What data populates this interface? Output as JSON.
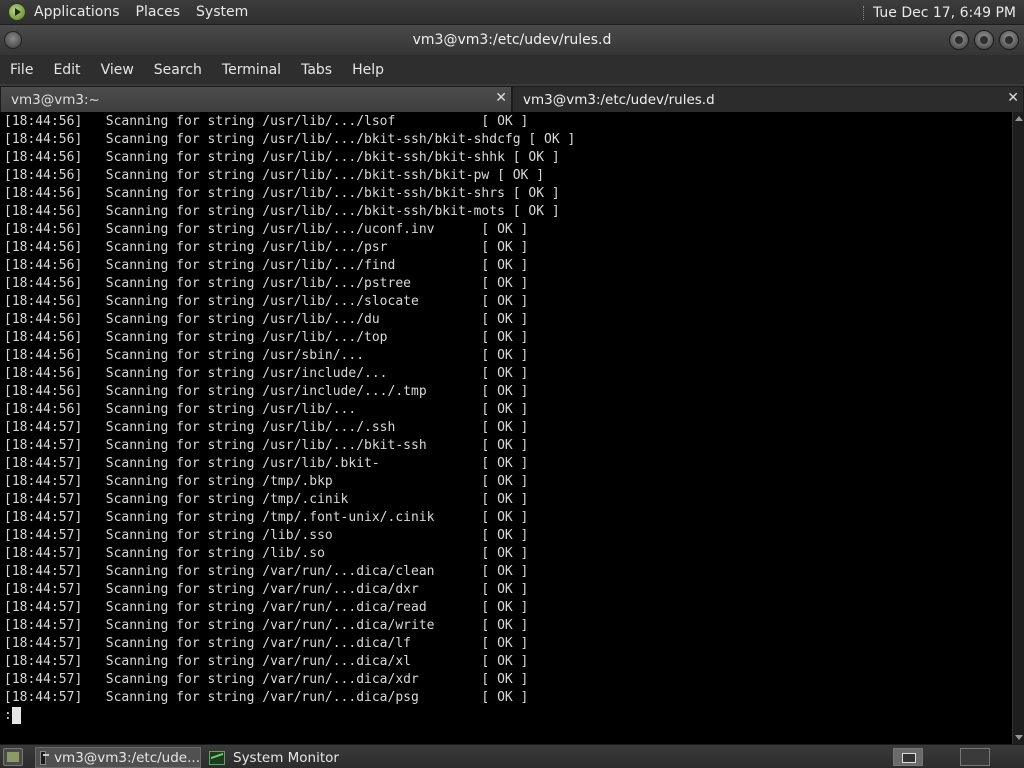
{
  "top_panel": {
    "menus": [
      "Applications",
      "Places",
      "System"
    ],
    "clock": "Tue Dec 17,  6:49 PM"
  },
  "window": {
    "title": "vm3@vm3:/etc/udev/rules.d"
  },
  "menubar": [
    "File",
    "Edit",
    "View",
    "Search",
    "Terminal",
    "Tabs",
    "Help"
  ],
  "tabs": [
    {
      "label": "vm3@vm3:~",
      "active": false
    },
    {
      "label": "vm3@vm3:/etc/udev/rules.d",
      "active": true
    }
  ],
  "terminal": {
    "lines": [
      "[18:44:56]   Scanning for string /usr/lib/.../lsof           [ OK ]",
      "[18:44:56]   Scanning for string /usr/lib/.../bkit-ssh/bkit-shdcfg [ OK ]",
      "[18:44:56]   Scanning for string /usr/lib/.../bkit-ssh/bkit-shhk [ OK ]",
      "[18:44:56]   Scanning for string /usr/lib/.../bkit-ssh/bkit-pw [ OK ]",
      "[18:44:56]   Scanning for string /usr/lib/.../bkit-ssh/bkit-shrs [ OK ]",
      "[18:44:56]   Scanning for string /usr/lib/.../bkit-ssh/bkit-mots [ OK ]",
      "[18:44:56]   Scanning for string /usr/lib/.../uconf.inv      [ OK ]",
      "[18:44:56]   Scanning for string /usr/lib/.../psr            [ OK ]",
      "[18:44:56]   Scanning for string /usr/lib/.../find           [ OK ]",
      "[18:44:56]   Scanning for string /usr/lib/.../pstree         [ OK ]",
      "[18:44:56]   Scanning for string /usr/lib/.../slocate        [ OK ]",
      "[18:44:56]   Scanning for string /usr/lib/.../du             [ OK ]",
      "[18:44:56]   Scanning for string /usr/lib/.../top            [ OK ]",
      "[18:44:56]   Scanning for string /usr/sbin/...               [ OK ]",
      "[18:44:56]   Scanning for string /usr/include/...            [ OK ]",
      "[18:44:56]   Scanning for string /usr/include/.../.tmp       [ OK ]",
      "[18:44:56]   Scanning for string /usr/lib/...                [ OK ]",
      "[18:44:57]   Scanning for string /usr/lib/.../.ssh           [ OK ]",
      "[18:44:57]   Scanning for string /usr/lib/.../bkit-ssh       [ OK ]",
      "[18:44:57]   Scanning for string /usr/lib/.bkit-             [ OK ]",
      "[18:44:57]   Scanning for string /tmp/.bkp                   [ OK ]",
      "[18:44:57]   Scanning for string /tmp/.cinik                 [ OK ]",
      "[18:44:57]   Scanning for string /tmp/.font-unix/.cinik      [ OK ]",
      "[18:44:57]   Scanning for string /lib/.sso                   [ OK ]",
      "[18:44:57]   Scanning for string /lib/.so                    [ OK ]",
      "[18:44:57]   Scanning for string /var/run/...dica/clean      [ OK ]",
      "[18:44:57]   Scanning for string /var/run/...dica/dxr        [ OK ]",
      "[18:44:57]   Scanning for string /var/run/...dica/read       [ OK ]",
      "[18:44:57]   Scanning for string /var/run/...dica/write      [ OK ]",
      "[18:44:57]   Scanning for string /var/run/...dica/lf         [ OK ]",
      "[18:44:57]   Scanning for string /var/run/...dica/xl         [ OK ]",
      "[18:44:57]   Scanning for string /var/run/...dica/xdr        [ OK ]",
      "[18:44:57]   Scanning for string /var/run/...dica/psg        [ OK ]"
    ],
    "prompt": ":"
  },
  "taskbar": {
    "tasks": [
      {
        "label": "vm3@vm3:/etc/ude...",
        "active": true,
        "icon": "terminal-icon"
      },
      {
        "label": "System Monitor",
        "active": false,
        "icon": "system-monitor-icon"
      }
    ]
  }
}
